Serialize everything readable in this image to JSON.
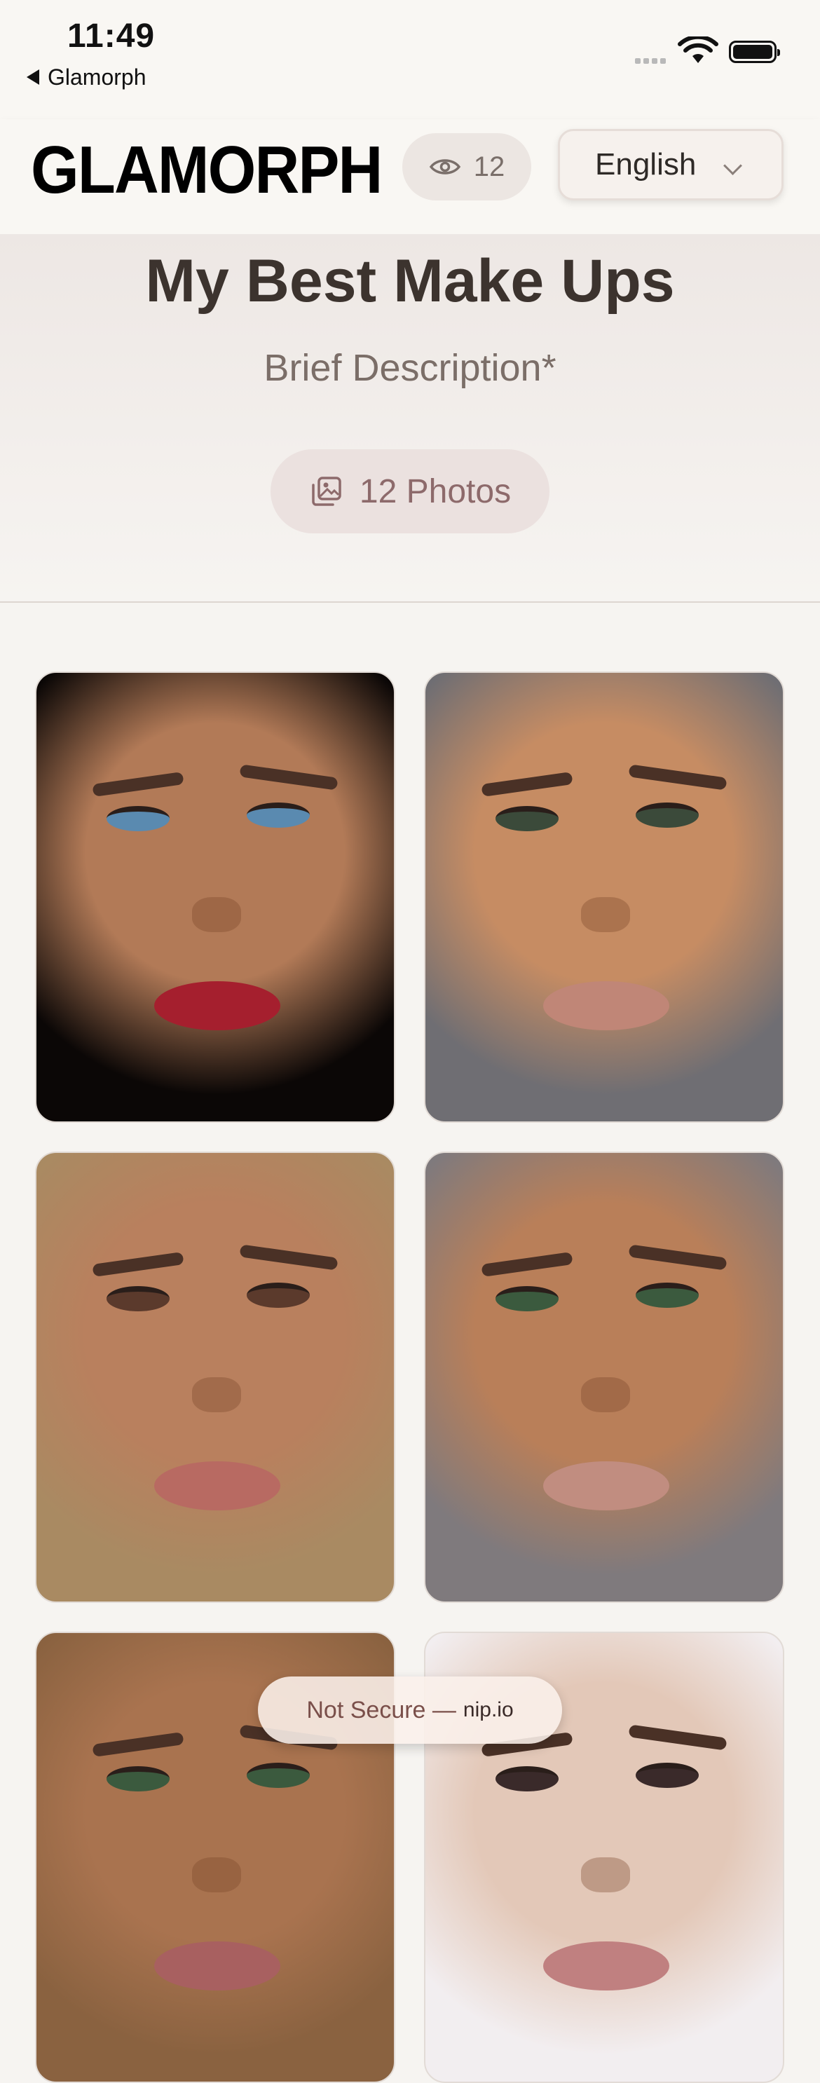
{
  "status_bar": {
    "time": "11:49",
    "back_app": "Glamorph"
  },
  "header": {
    "logo": "GLAMORPH",
    "view_count": "12",
    "language": "English"
  },
  "hero": {
    "title": "My Best Make Ups",
    "description": "Brief Description*",
    "photos_label": "12 Photos"
  },
  "gallery": {
    "items": [
      {
        "alt": "photo-1",
        "skin": "#b27a57",
        "bg": "#0b0706",
        "lips": "#a51f2e",
        "eyes": "#5a8ab0"
      },
      {
        "alt": "photo-2",
        "skin": "#c68c63",
        "bg": "#6f6e73",
        "lips": "#c08677",
        "eyes": "#3b4a3a"
      },
      {
        "alt": "photo-3",
        "skin": "#b9805e",
        "bg": "#a98a62",
        "lips": "#b86a62",
        "eyes": "#5b3a2c"
      },
      {
        "alt": "photo-4",
        "skin": "#b97f59",
        "bg": "#7f7a7d",
        "lips": "#c18d80",
        "eyes": "#3b5a3e"
      },
      {
        "alt": "photo-5",
        "skin": "#a9734f",
        "bg": "#8a6240",
        "lips": "#a86060",
        "eyes": "#3b5a3e"
      },
      {
        "alt": "photo-6",
        "skin": "#e3c8b8",
        "bg": "#f2eef0",
        "lips": "#c08080",
        "eyes": "#3a2a2a"
      }
    ]
  },
  "browser": {
    "url_prefix": "Not Secure —",
    "url_host": "nip.io"
  },
  "colors": {
    "accent": "#8d6a6b",
    "background": "#f6f4f1",
    "title": "#3c332e"
  }
}
